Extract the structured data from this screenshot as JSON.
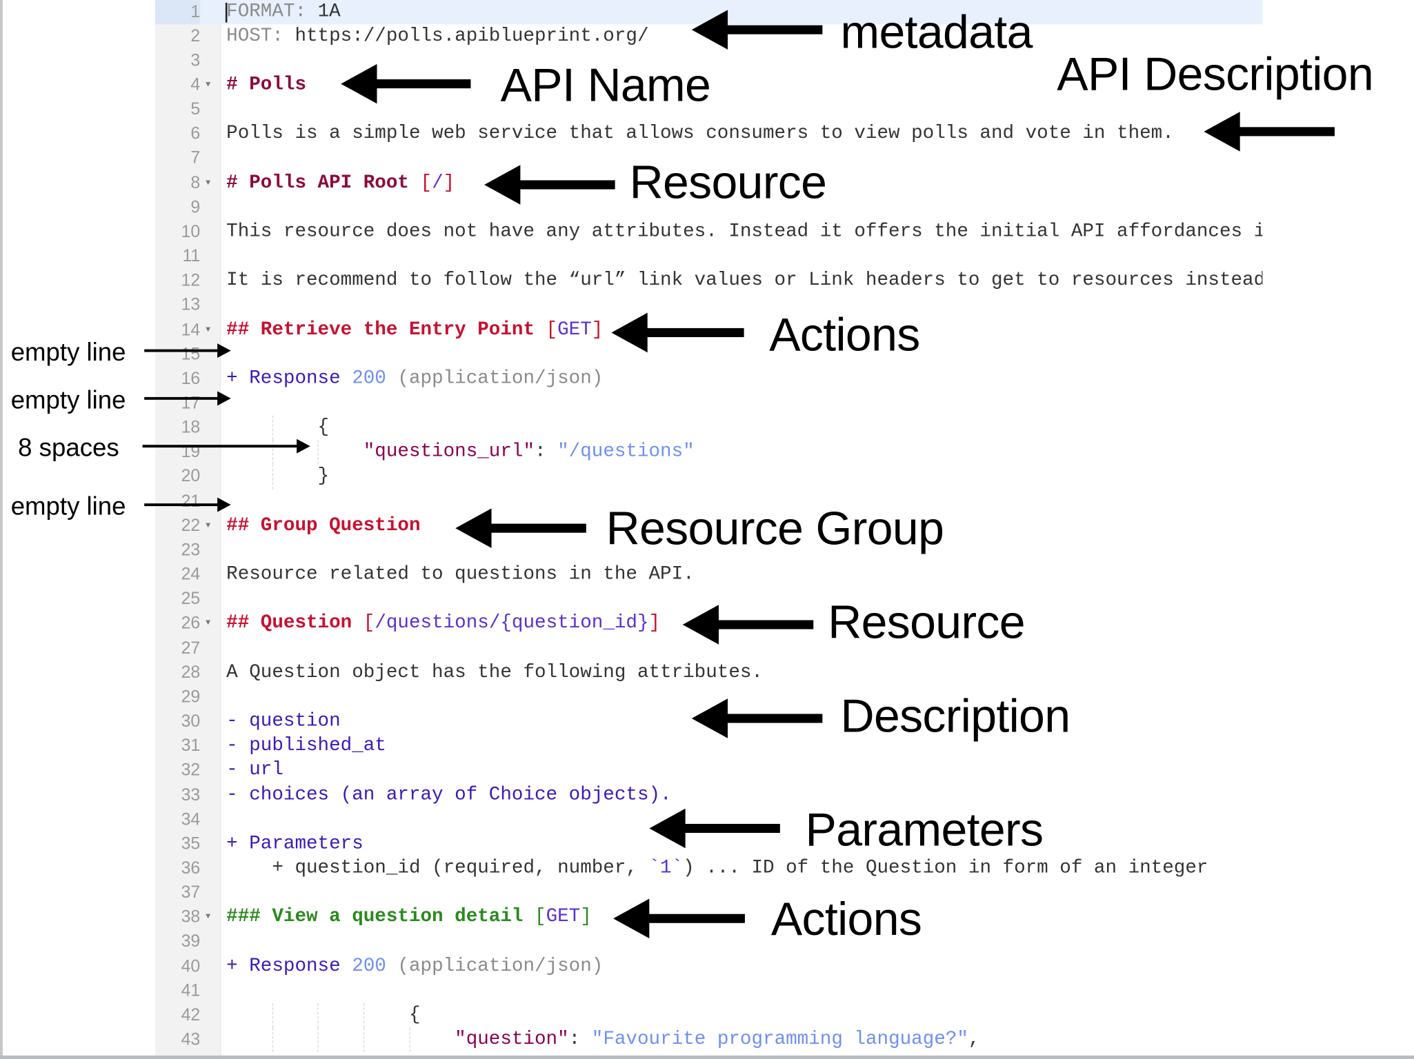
{
  "editor": {
    "active_line": 1,
    "lines": [
      {
        "n": 1,
        "segs": [
          {
            "t": "FORMAT: ",
            "k": "meta"
          },
          {
            "t": "1A",
            "k": "text"
          }
        ]
      },
      {
        "n": 2,
        "segs": [
          {
            "t": "HOST: ",
            "k": "meta"
          },
          {
            "t": "https://polls.apiblueprint.org/",
            "k": "text"
          }
        ]
      },
      {
        "n": 3,
        "segs": []
      },
      {
        "n": 4,
        "fold": true,
        "segs": [
          {
            "t": "# Polls",
            "k": "h1"
          }
        ]
      },
      {
        "n": 5,
        "segs": []
      },
      {
        "n": 6,
        "segs": [
          {
            "t": "Polls is a simple web service that allows consumers to view polls and vote in them.",
            "k": "text"
          }
        ]
      },
      {
        "n": 7,
        "segs": []
      },
      {
        "n": 8,
        "fold": true,
        "segs": [
          {
            "t": "# Polls API Root ",
            "k": "h1"
          },
          {
            "t": "[",
            "k": "brk-red"
          },
          {
            "t": "/",
            "k": "uri"
          },
          {
            "t": "]",
            "k": "brk-red"
          }
        ]
      },
      {
        "n": 9,
        "segs": []
      },
      {
        "n": 10,
        "segs": [
          {
            "t": "This resource does not have any attributes. Instead it offers the initial API affordances i",
            "k": "text"
          }
        ]
      },
      {
        "n": 11,
        "segs": []
      },
      {
        "n": 12,
        "segs": [
          {
            "t": "It is recommend to follow the “url” link values or Link headers to get to resources instead",
            "k": "text"
          }
        ]
      },
      {
        "n": 13,
        "segs": []
      },
      {
        "n": 14,
        "fold": true,
        "segs": [
          {
            "t": "## Retrieve the Entry Point ",
            "k": "h2"
          },
          {
            "t": "[",
            "k": "brk-red"
          },
          {
            "t": "GET",
            "k": "uri"
          },
          {
            "t": "]",
            "k": "brk-red"
          }
        ]
      },
      {
        "n": 15,
        "segs": []
      },
      {
        "n": 16,
        "segs": [
          {
            "t": "+ Response ",
            "k": "kw"
          },
          {
            "t": "200",
            "k": "num"
          },
          {
            "t": " (application/json)",
            "k": "gray"
          }
        ]
      },
      {
        "n": 17,
        "segs": []
      },
      {
        "n": 18,
        "guides": [
          4
        ],
        "segs": [
          {
            "t": "        {",
            "k": "text"
          }
        ]
      },
      {
        "n": 19,
        "guides": [
          4,
          8
        ],
        "segs": [
          {
            "t": "            ",
            "k": "text"
          },
          {
            "t": "\"questions_url\"",
            "k": "key"
          },
          {
            "t": ": ",
            "k": "text"
          },
          {
            "t": "\"/questions\"",
            "k": "str"
          }
        ]
      },
      {
        "n": 20,
        "guides": [
          4
        ],
        "segs": [
          {
            "t": "        }",
            "k": "text"
          }
        ]
      },
      {
        "n": 21,
        "segs": []
      },
      {
        "n": 22,
        "fold": true,
        "segs": [
          {
            "t": "## Group Question",
            "k": "h2"
          }
        ]
      },
      {
        "n": 23,
        "segs": []
      },
      {
        "n": 24,
        "segs": [
          {
            "t": "Resource related to questions in the API.",
            "k": "text"
          }
        ]
      },
      {
        "n": 25,
        "segs": []
      },
      {
        "n": 26,
        "fold": true,
        "segs": [
          {
            "t": "## Question ",
            "k": "h2"
          },
          {
            "t": "[",
            "k": "brk-red"
          },
          {
            "t": "/questions/{question_id}",
            "k": "uri"
          },
          {
            "t": "]",
            "k": "brk-red"
          }
        ]
      },
      {
        "n": 27,
        "segs": []
      },
      {
        "n": 28,
        "segs": [
          {
            "t": "A Question object has the following attributes.",
            "k": "text"
          }
        ]
      },
      {
        "n": 29,
        "segs": []
      },
      {
        "n": 30,
        "segs": [
          {
            "t": "- question",
            "k": "list"
          }
        ]
      },
      {
        "n": 31,
        "segs": [
          {
            "t": "- published_at",
            "k": "list"
          }
        ]
      },
      {
        "n": 32,
        "segs": [
          {
            "t": "- url",
            "k": "list"
          }
        ]
      },
      {
        "n": 33,
        "segs": [
          {
            "t": "- choices (an array of Choice objects).",
            "k": "list"
          }
        ]
      },
      {
        "n": 34,
        "segs": []
      },
      {
        "n": 35,
        "segs": [
          {
            "t": "+ Parameters",
            "k": "kw"
          }
        ]
      },
      {
        "n": 36,
        "segs": [
          {
            "t": "    + question_id (required, number, ",
            "k": "text"
          },
          {
            "t": "`1`",
            "k": "uri"
          },
          {
            "t": ") ... ID of the Question in form of an integer",
            "k": "text"
          }
        ]
      },
      {
        "n": 37,
        "segs": []
      },
      {
        "n": 38,
        "fold": true,
        "segs": [
          {
            "t": "### View a question detail ",
            "k": "h3"
          },
          {
            "t": "[",
            "k": "brk-green"
          },
          {
            "t": "GET",
            "k": "uri"
          },
          {
            "t": "]",
            "k": "brk-green"
          }
        ]
      },
      {
        "n": 39,
        "segs": []
      },
      {
        "n": 40,
        "segs": [
          {
            "t": "+ Response ",
            "k": "kw"
          },
          {
            "t": "200",
            "k": "num"
          },
          {
            "t": " (application/json)",
            "k": "gray"
          }
        ]
      },
      {
        "n": 41,
        "segs": []
      },
      {
        "n": 42,
        "guides": [
          4,
          8,
          12
        ],
        "segs": [
          {
            "t": "                {",
            "k": "text"
          }
        ]
      },
      {
        "n": 43,
        "guides": [
          4,
          8,
          12,
          16
        ],
        "segs": [
          {
            "t": "                    ",
            "k": "text"
          },
          {
            "t": "\"question\"",
            "k": "key"
          },
          {
            "t": ": ",
            "k": "text"
          },
          {
            "t": "\"Favourite programming language?\"",
            "k": "str"
          },
          {
            "t": ",",
            "k": "text"
          }
        ]
      }
    ]
  },
  "annotations": {
    "metadata": "metadata",
    "api_name": "API Name",
    "api_description": "API Description",
    "resource_1": "Resource",
    "actions_1": "Actions",
    "resource_group": "Resource Group",
    "resource_2": "Resource",
    "description": "Description",
    "parameters": "Parameters",
    "actions_2": "Actions",
    "empty_line_1": "empty line",
    "empty_line_2": "empty line",
    "eight_spaces": "8 spaces",
    "empty_line_3": "empty line"
  }
}
